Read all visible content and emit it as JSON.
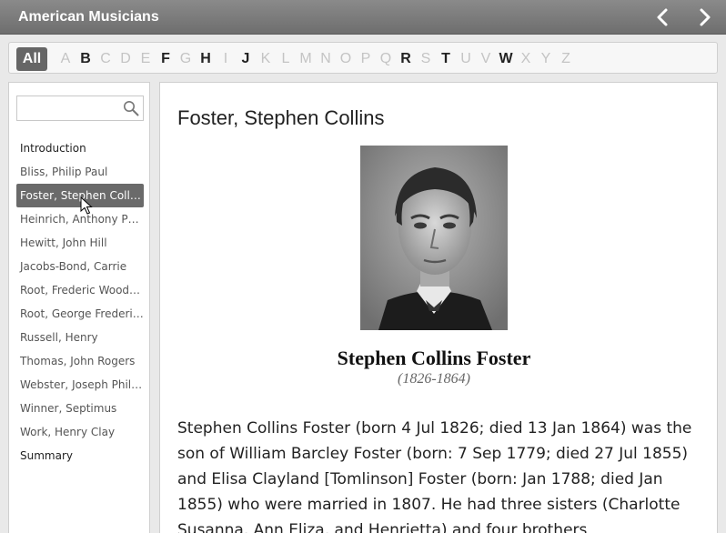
{
  "app": {
    "title": "American Musicians"
  },
  "alphabet": {
    "all_label": "All",
    "letters": [
      {
        "char": "A",
        "enabled": false
      },
      {
        "char": "B",
        "enabled": true
      },
      {
        "char": "C",
        "enabled": false
      },
      {
        "char": "D",
        "enabled": false
      },
      {
        "char": "E",
        "enabled": false
      },
      {
        "char": "F",
        "enabled": true
      },
      {
        "char": "G",
        "enabled": false
      },
      {
        "char": "H",
        "enabled": true
      },
      {
        "char": "I",
        "enabled": false
      },
      {
        "char": "J",
        "enabled": true
      },
      {
        "char": "K",
        "enabled": false
      },
      {
        "char": "L",
        "enabled": false
      },
      {
        "char": "M",
        "enabled": false
      },
      {
        "char": "N",
        "enabled": false
      },
      {
        "char": "O",
        "enabled": false
      },
      {
        "char": "P",
        "enabled": false
      },
      {
        "char": "Q",
        "enabled": false
      },
      {
        "char": "R",
        "enabled": true
      },
      {
        "char": "S",
        "enabled": false
      },
      {
        "char": "T",
        "enabled": true
      },
      {
        "char": "U",
        "enabled": false
      },
      {
        "char": "V",
        "enabled": false
      },
      {
        "char": "W",
        "enabled": true
      },
      {
        "char": "X",
        "enabled": false
      },
      {
        "char": "Y",
        "enabled": false
      },
      {
        "char": "Z",
        "enabled": false
      }
    ]
  },
  "search": {
    "placeholder": "",
    "value": ""
  },
  "toc": [
    {
      "label": "Introduction",
      "section": true,
      "active": false
    },
    {
      "label": "Bliss, Philip Paul",
      "section": false,
      "active": false
    },
    {
      "label": "Foster, Stephen Collins",
      "section": false,
      "active": true
    },
    {
      "label": "Heinrich, Anthony Philip",
      "section": false,
      "active": false
    },
    {
      "label": "Hewitt, John Hill",
      "section": false,
      "active": false
    },
    {
      "label": "Jacobs-Bond, Carrie",
      "section": false,
      "active": false
    },
    {
      "label": "Root, Frederic Woodman",
      "section": false,
      "active": false
    },
    {
      "label": "Root, George Frederick",
      "section": false,
      "active": false
    },
    {
      "label": "Russell, Henry",
      "section": false,
      "active": false
    },
    {
      "label": "Thomas, John Rogers",
      "section": false,
      "active": false
    },
    {
      "label": "Webster, Joseph Philbrick",
      "section": false,
      "active": false
    },
    {
      "label": "Winner, Septimus",
      "section": false,
      "active": false
    },
    {
      "label": "Work, Henry Clay",
      "section": false,
      "active": false
    },
    {
      "label": "Summary",
      "section": true,
      "active": false
    }
  ],
  "article": {
    "title": "Foster, Stephen Collins",
    "name": "Stephen Collins Foster",
    "dates": "(1826-1864)",
    "body": "Stephen Collins Foster (born 4 Jul 1826; died 13 Jan 1864) was the son of William Barcley Foster (born: 7 Sep 1779; died 27 Jul 1855) and Elisa Clayland [Tomlinson] Foster (born: Jan 1788; died Jan 1855) who were married in 1807. He had three sisters (Charlotte Susanna, Ann Eliza, and Henrietta) and four brothers"
  },
  "colors": {
    "titlebar": "#7a7a7a",
    "active_item": "#6a6a6a",
    "disabled_letter": "#c4c4c4"
  }
}
